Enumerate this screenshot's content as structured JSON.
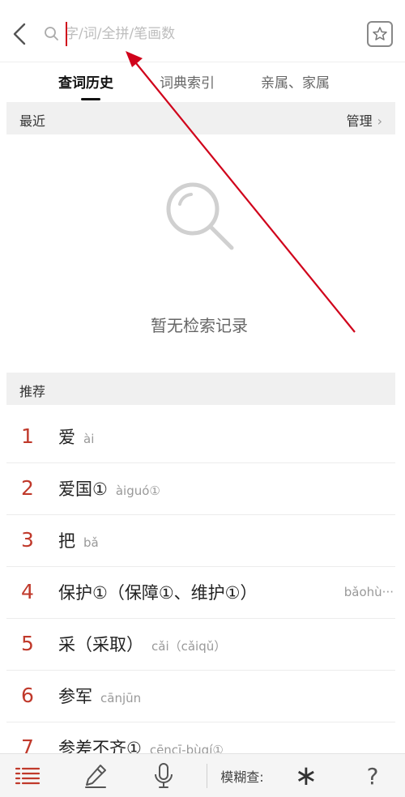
{
  "search": {
    "placeholder": "字/词/全拼/笔画数",
    "value": ""
  },
  "tabs": [
    {
      "label": "查词历史",
      "active": true
    },
    {
      "label": "词典索引",
      "active": false
    },
    {
      "label": "亲属、家属",
      "active": false
    }
  ],
  "recent": {
    "title": "最近",
    "manage_label": "管理",
    "empty_text": "暂无检索记录"
  },
  "recommend": {
    "title": "推荐",
    "items": [
      {
        "num": "1",
        "word": "爱",
        "pinyin": "ài"
      },
      {
        "num": "2",
        "word": "爱国①",
        "pinyin": "àiguó①"
      },
      {
        "num": "3",
        "word": "把",
        "pinyin": "bǎ"
      },
      {
        "num": "4",
        "word": "保护①（保障①、维护①）",
        "pinyin": "bǎohù···"
      },
      {
        "num": "5",
        "word": "采（采取）",
        "pinyin": "cǎi（cǎiqǔ）"
      },
      {
        "num": "6",
        "word": "参军",
        "pinyin": "cānjūn"
      },
      {
        "num": "7",
        "word": "参差不齐①",
        "pinyin": "cēncī-bùqí①"
      }
    ]
  },
  "bottombar": {
    "fuzzy_label": "模糊查:",
    "star": "∗",
    "question": "?"
  },
  "colors": {
    "accent": "#c0392b",
    "annotation": "#d0021b",
    "section_bg": "#f0f0f0"
  },
  "icons": [
    "back-icon",
    "search-icon",
    "star-folder-icon",
    "magnifier-empty-icon",
    "menu-list-icon",
    "pencil-icon",
    "microphone-icon"
  ]
}
